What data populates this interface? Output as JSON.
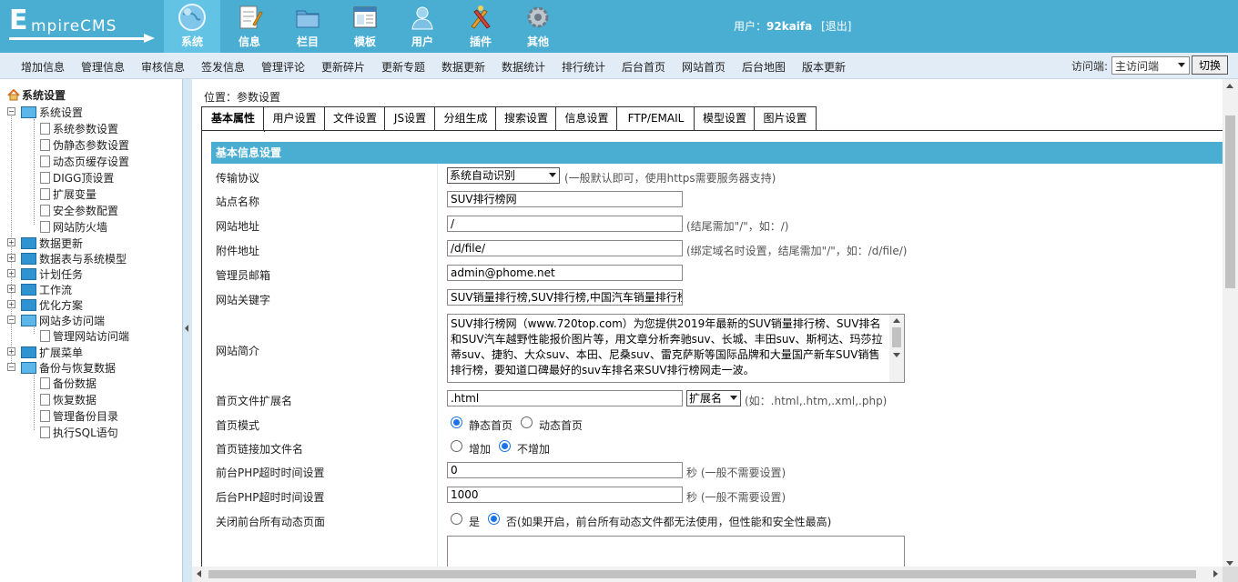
{
  "app": {
    "logo_big": "E",
    "logo_small": "mpireCMS",
    "colors": {
      "header": "#4aaed3",
      "header_active": "#62c3e5",
      "submenu": "#e1ecf6",
      "section_head": "#4aaed3"
    }
  },
  "topnav": [
    {
      "label": "系统",
      "icon": "globe-icon",
      "active": true
    },
    {
      "label": "信息",
      "icon": "notepad-icon",
      "active": false
    },
    {
      "label": "栏目",
      "icon": "folder-icon",
      "active": false
    },
    {
      "label": "模板",
      "icon": "template-window-icon",
      "active": false
    },
    {
      "label": "用户",
      "icon": "user-icon",
      "active": false
    },
    {
      "label": "插件",
      "icon": "tools-icon",
      "active": false
    },
    {
      "label": "其他",
      "icon": "gear-icon",
      "active": false
    }
  ],
  "user": {
    "prefix": "用户：",
    "name": "92kaifa",
    "logout": "[退出]"
  },
  "submenu": [
    "增加信息",
    "管理信息",
    "审核信息",
    "签发信息",
    "管理评论",
    "更新碎片",
    "更新专题",
    "数据更新",
    "数据统计",
    "排行统计",
    "后台首页",
    "网站首页",
    "后台地图",
    "版本更新"
  ],
  "visit": {
    "label": "访问端:",
    "selected": "主访问端",
    "switch": "切换"
  },
  "sidebar": {
    "root": "系统设置",
    "items": [
      {
        "label": "系统设置",
        "type": "folder-open"
      },
      {
        "label": "系统参数设置",
        "type": "page"
      },
      {
        "label": "伪静态参数设置",
        "type": "page"
      },
      {
        "label": "动态页缓存设置",
        "type": "page"
      },
      {
        "label": "DIGG顶设置",
        "type": "page"
      },
      {
        "label": "扩展变量",
        "type": "page"
      },
      {
        "label": "安全参数配置",
        "type": "page"
      },
      {
        "label": "网站防火墙",
        "type": "page"
      },
      {
        "label": "数据更新",
        "type": "folder"
      },
      {
        "label": "数据表与系统模型",
        "type": "folder"
      },
      {
        "label": "计划任务",
        "type": "folder"
      },
      {
        "label": "工作流",
        "type": "folder"
      },
      {
        "label": "优化方案",
        "type": "folder"
      },
      {
        "label": "网站多访问端",
        "type": "folder-open"
      },
      {
        "label": "管理网站访问端",
        "type": "page"
      },
      {
        "label": "扩展菜单",
        "type": "folder"
      },
      {
        "label": "备份与恢复数据",
        "type": "folder-open"
      },
      {
        "label": "备份数据",
        "type": "page"
      },
      {
        "label": "恢复数据",
        "type": "page"
      },
      {
        "label": "管理备份目录",
        "type": "page"
      },
      {
        "label": "执行SQL语句",
        "type": "page"
      }
    ]
  },
  "main": {
    "location": "位置：参数设置",
    "tabs": [
      "基本属性",
      "用户设置",
      "文件设置",
      "JS设置",
      "分组生成",
      "搜索设置",
      "信息设置",
      "FTP/EMAIL",
      "模型设置",
      "图片设置"
    ],
    "section_title": "基本信息设置",
    "fields": {
      "protocol": {
        "label": "传输协议",
        "value": "系统自动识别",
        "hint": "(一般默认即可，使用https需要服务器支持)"
      },
      "sitename": {
        "label": "站点名称",
        "value": "SUV排行榜网"
      },
      "siteurl": {
        "label": "网站地址",
        "value": "/",
        "hint": "(结尾需加\"/\"，如：/)"
      },
      "fileurl": {
        "label": "附件地址",
        "value": "/d/file/",
        "hint": "(绑定域名时设置，结尾需加\"/\"，如：/d/file/)"
      },
      "email": {
        "label": "管理员邮箱",
        "value": "admin@phome.net"
      },
      "keywords": {
        "label": "网站关键字",
        "value": "SUV销量排行榜,SUV排行榜,中国汽车销量排行榜"
      },
      "intro": {
        "label": "网站简介",
        "value": "SUV排行榜网（www.720top.com）为您提供2019年最新的SUV销量排行榜、SUV排名和SUV汽车越野性能报价图片等，用文章分析奔驰suv、长城、丰田suv、斯柯达、玛莎拉蒂suv、捷豹、大众suv、本田、尼桑suv、雷克萨斯等国际品牌和大量国产新车SUV销售排行榜，要知道口碑最好的suv车排名来SUV排行榜网走一波。"
      },
      "ext": {
        "label": "首页文件扩展名",
        "value": ".html",
        "select": "扩展名",
        "hint": "(如：.html,.htm,.xml,.php)"
      },
      "mode": {
        "label": "首页模式",
        "opt1": "静态首页",
        "opt2": "动态首页"
      },
      "linkfile": {
        "label": "首页链接加文件名",
        "opt1": "增加",
        "opt2": "不增加"
      },
      "fronttimeout": {
        "label": "前台PHP超时时间设置",
        "value": "0",
        "hint": "秒 (一般不需要设置)"
      },
      "backtimeout": {
        "label": "后台PHP超时时间设置",
        "value": "1000",
        "hint": "秒 (一般不需要设置)"
      },
      "closedyn": {
        "label": "关闭前台所有动态页面",
        "opt1": "是",
        "opt2": "否(如果开启，前台所有动态文件都无法使用，但性能和安全性最高)"
      }
    }
  }
}
